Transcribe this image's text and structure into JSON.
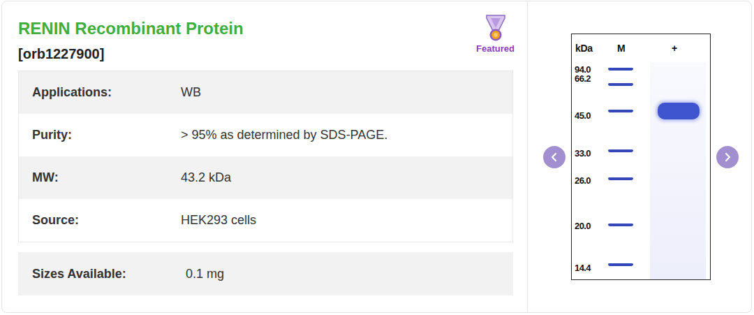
{
  "product": {
    "title": "RENIN Recombinant Protein",
    "catalog": "[orb1227900]",
    "badge": "Featured"
  },
  "specs": [
    {
      "label": "Applications:",
      "value": "WB"
    },
    {
      "label": "Purity:",
      "value": "> 95% as determined by SDS-PAGE."
    },
    {
      "label": "MW:",
      "value": "43.2 kDa"
    },
    {
      "label": "Source:",
      "value": "HEK293 cells"
    }
  ],
  "sizes": {
    "label": "Sizes Available:",
    "value": "0.1 mg"
  },
  "gel": {
    "unit": "kDa",
    "lanes": [
      {
        "label": "M",
        "kind": "ladder"
      },
      {
        "label": "+",
        "kind": "sample"
      }
    ],
    "ladder": [
      "94.0",
      "66.2",
      "45.0",
      "33.0",
      "26.0",
      "20.0",
      "14.4"
    ]
  }
}
